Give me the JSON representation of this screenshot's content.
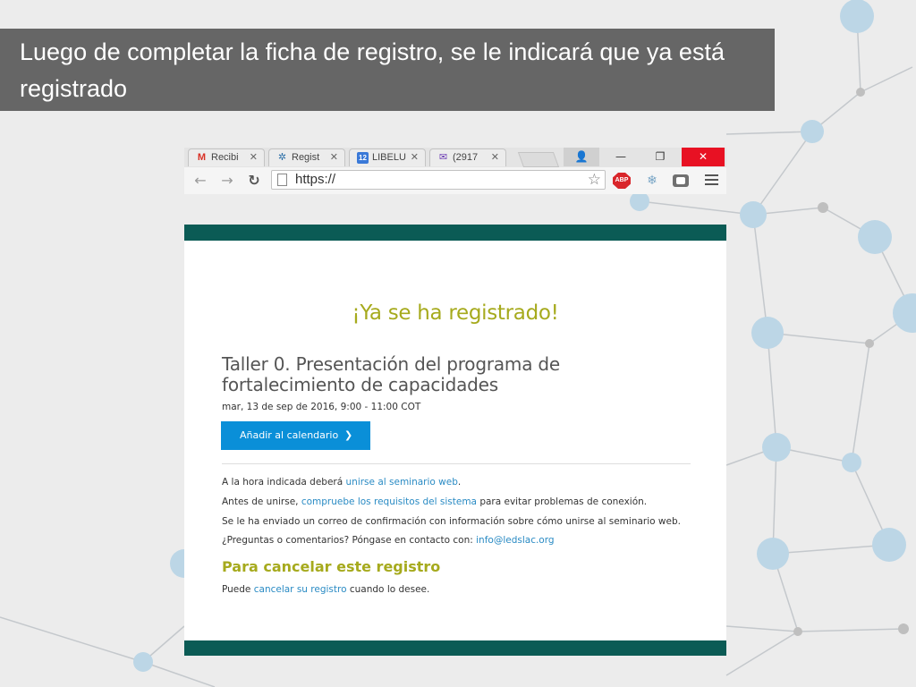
{
  "slide": {
    "title": "Luego de completar la ficha de registro, se le indicará que ya está registrado"
  },
  "browser": {
    "tabs": [
      {
        "label": "Recibi",
        "icon": "gmail-icon"
      },
      {
        "label": "Regist",
        "icon": "gear-icon"
      },
      {
        "label": "LIBELU",
        "icon": "calendar-icon",
        "badge": "12"
      },
      {
        "label": "(2917",
        "icon": "mail-icon"
      }
    ],
    "url": "https://",
    "extensions": [
      "adblock-icon",
      "snowflake-icon",
      "chat-icon"
    ],
    "abp_label": "ABP"
  },
  "page": {
    "success_heading": "¡Ya se ha registrado!",
    "event_title": "Taller 0. Presentación del programa de fortalecimiento de capacidades",
    "event_date": "mar, 13 de sep de 2016, 9:00 - 11:00 COT",
    "calendar_button": "Añadir al calendario",
    "line1": {
      "pre": "A la hora indicada deberá ",
      "link": "unirse al seminario web",
      "post": "."
    },
    "line2": {
      "pre": "Antes de unirse, ",
      "link": "compruebe los requisitos del sistema",
      "post": " para evitar problemas de conexión."
    },
    "line3": {
      "pre": "Se le ha enviado un correo de confirmación con información sobre cómo unirse al seminario web."
    },
    "line4": {
      "pre": "¿Preguntas o comentarios? Póngase en contacto con: ",
      "link": "info@ledslac.org"
    },
    "cancel_heading": "Para cancelar este registro",
    "line5": {
      "pre": "Puede ",
      "link": "cancelar su registro",
      "post": " cuando lo desee."
    }
  },
  "colors": {
    "header_bar": "#0b5b55",
    "accent_olive": "#a6aa1d",
    "link": "#2a8bc4",
    "button": "#0a8fd8",
    "title_box": "#666666"
  }
}
